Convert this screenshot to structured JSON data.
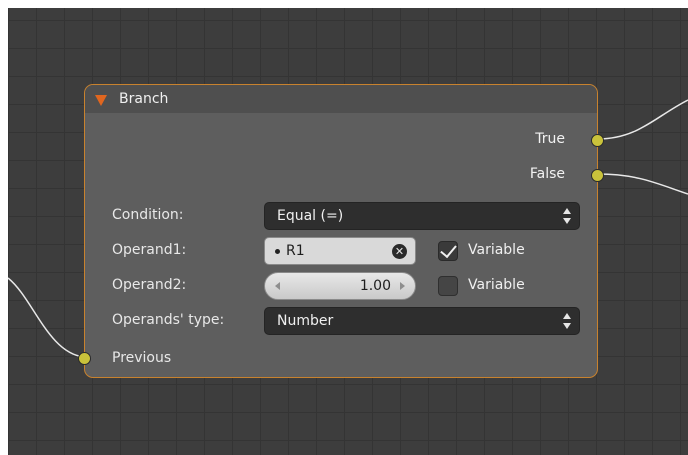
{
  "node": {
    "title": "Branch",
    "header_color": "#4f4f4f",
    "border_color": "#c8822e",
    "outputs": [
      "True",
      "False"
    ],
    "input": "Previous"
  },
  "fields": {
    "condition": {
      "label": "Condition:",
      "value": "Equal (=)"
    },
    "operand1": {
      "label": "Operand1:",
      "value": "R1",
      "variable_label": "Variable",
      "variable_checked": true
    },
    "operand2": {
      "label": "Operand2:",
      "value": "1.00",
      "variable_label": "Variable",
      "variable_checked": false
    },
    "operands_type": {
      "label": "Operands' type:",
      "value": "Number"
    }
  },
  "icons": {
    "collapse": "collapse-triangle-icon",
    "clear": "clear-x-icon",
    "dropdown": "updown-arrows-icon",
    "socket": "socket-dot-icon"
  },
  "colors": {
    "socket": "#c9c23b",
    "collapse_triangle": "#e0661f",
    "grid_bg": "#3d3d3d"
  }
}
